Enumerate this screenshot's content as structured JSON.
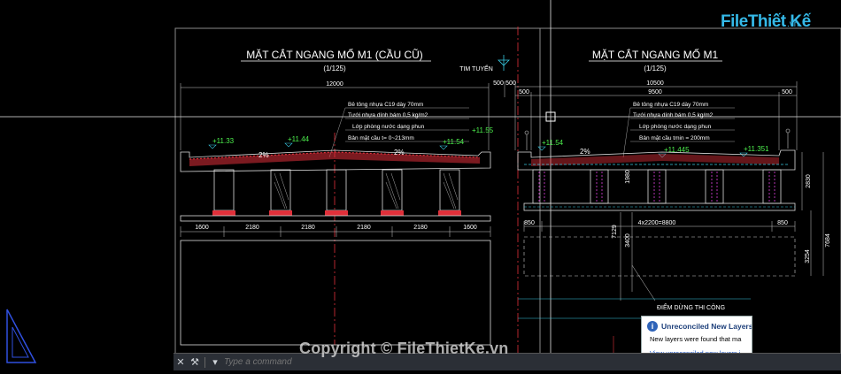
{
  "left_section": {
    "title": "MẶT CẮT NGANG MỐ M1 (CẦU CŨ)",
    "scale": "(1/125)",
    "overall_width": "12000",
    "tim_tuyen": "TIM TUYẾN",
    "layers": [
      "Bê tông nhựa C19 dày 70mm",
      "Tưới nhựa dính bám 0,5 kg/m2",
      "Lớp phòng nước dạng phun",
      "Bản mặt cầu t= 0~213mm"
    ],
    "elevations": [
      "+11.33",
      "+11.44",
      "+11.54",
      "+11.55"
    ],
    "slopes": [
      "2%",
      "2%"
    ],
    "spacings": [
      "1600",
      "2180",
      "2180",
      "2180",
      "2180",
      "1600"
    ]
  },
  "right_section": {
    "title": "MẶT CẮT NGANG MỐ M1",
    "scale": "(1/125)",
    "overall_width": "10500",
    "inner_width": "9500",
    "edge_left": "500",
    "edge_right": "500",
    "edge_top_left": "500",
    "edge_top_right": "500",
    "layers": [
      "Bê tông nhựa C19 dày 70mm",
      "Tưới nhựa dính bám 0,5 kg/m2",
      "Lớp phòng nước dạng phun",
      "Bản mặt cầu tmin = 200mm"
    ],
    "elevations": [
      "+11.54",
      "+11.445",
      "+11.351"
    ],
    "slope": "2%",
    "girder_spacing": "4x2200=8800",
    "end_left": "850",
    "end_right": "850",
    "dims_vertical": [
      "1980",
      "7129",
      "3400",
      "2830",
      "3254",
      "7684"
    ],
    "note": "ĐIỂM DỪNG THI CÔNG"
  },
  "command_line": {
    "close": "✕",
    "options": "⚒",
    "history": "▾",
    "placeholder": "Type a command"
  },
  "notification": {
    "title": "Unreconciled New Layers",
    "body": "New layers were found that ma",
    "link": "View unreconciled new layers i"
  },
  "logo": {
    "main": "FileThiết Kế",
    "suffix": ".vn"
  },
  "watermark": "Copyright © FileThietKe.vn",
  "colors": {
    "background": "#000000",
    "red_hatch": "#e0303a",
    "green_text": "#4df04d",
    "magenta": "#e040e0",
    "cyan": "#38c8e0",
    "yellow": "#e8e840"
  }
}
